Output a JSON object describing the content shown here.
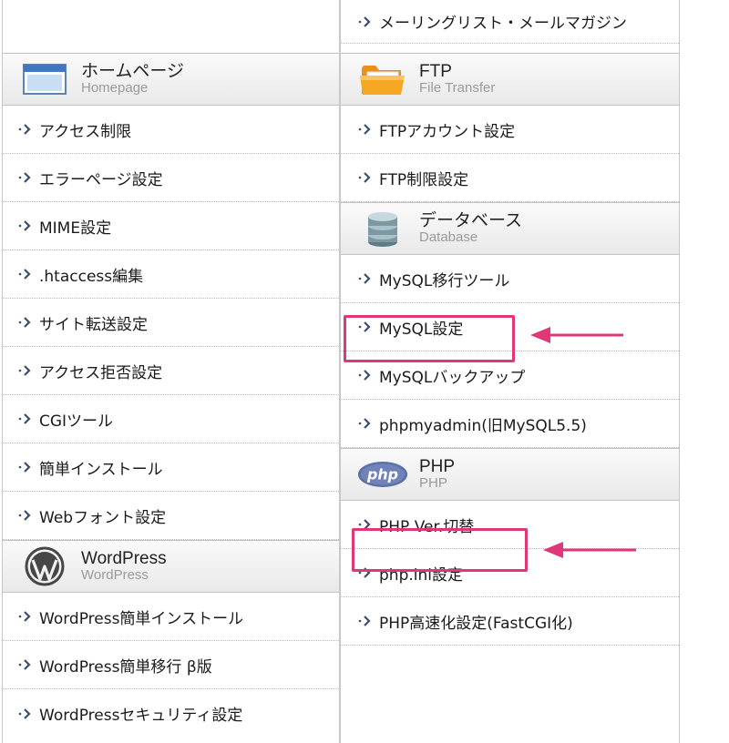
{
  "left_column": {
    "homepage_section": {
      "title": "ホームページ",
      "subtitle": "Homepage",
      "items": [
        {
          "label": "アクセス制限"
        },
        {
          "label": "エラーページ設定"
        },
        {
          "label": "MIME設定"
        },
        {
          "label": ".htaccess編集"
        },
        {
          "label": "サイト転送設定"
        },
        {
          "label": "アクセス拒否設定"
        },
        {
          "label": "CGIツール"
        },
        {
          "label": "簡単インストール"
        },
        {
          "label": "Webフォント設定"
        }
      ]
    },
    "wordpress_section": {
      "title": "WordPress",
      "subtitle": "WordPress",
      "items": [
        {
          "label": "WordPress簡単インストール"
        },
        {
          "label": "WordPress簡単移行 β版"
        },
        {
          "label": "WordPressセキュリティ設定"
        }
      ]
    }
  },
  "right_column": {
    "top_item": {
      "label": "メーリングリスト・メールマガジン"
    },
    "ftp_section": {
      "title": "FTP",
      "subtitle": "File Transfer",
      "items": [
        {
          "label": "FTPアカウント設定"
        },
        {
          "label": "FTP制限設定"
        }
      ]
    },
    "database_section": {
      "title": "データベース",
      "subtitle": "Database",
      "items": [
        {
          "label": "MySQL移行ツール"
        },
        {
          "label": "MySQL設定"
        },
        {
          "label": "MySQLバックアップ"
        },
        {
          "label": "phpmyadmin(旧MySQL5.5)"
        }
      ]
    },
    "php_section": {
      "title": "PHP",
      "subtitle": "PHP",
      "icon_text": "php",
      "items": [
        {
          "label": "PHP Ver.切替"
        },
        {
          "label": "php.ini設定"
        },
        {
          "label": "PHP高速化設定(FastCGI化)"
        }
      ]
    }
  },
  "colors": {
    "highlight": "#e0377a",
    "chevron": "#3a4e6e",
    "header_bg": "#ececec"
  }
}
